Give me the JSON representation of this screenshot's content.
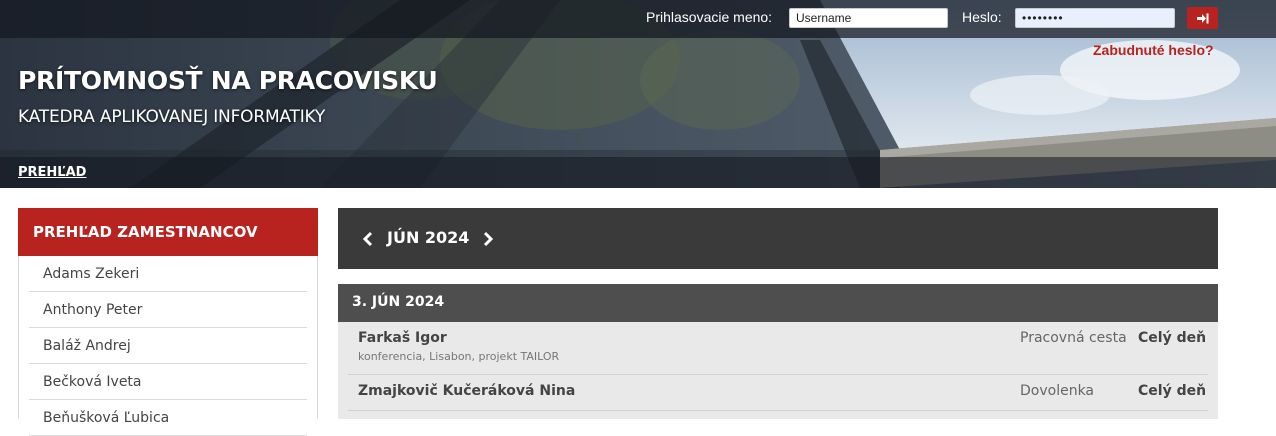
{
  "login": {
    "username_label": "Prihlasovacie meno:",
    "username_value": "Username",
    "password_label": "Heslo:",
    "password_value": "••••••••",
    "submit_icon": "sign-in-icon",
    "forgot_link": "Zabudnuté heslo?"
  },
  "header": {
    "title": "PRÍTOMNOSŤ NA PRACOVISKU",
    "subtitle": "KATEDRA APLIKOVANEJ INFORMATIKY"
  },
  "nav": {
    "items": [
      {
        "label": "PREHĽAD"
      }
    ]
  },
  "sidebar": {
    "title": "PREHĽAD ZAMESTNANCOV",
    "employees": [
      {
        "name": "Adams Zekeri"
      },
      {
        "name": "Anthony Peter"
      },
      {
        "name": "Baláž Andrej"
      },
      {
        "name": "Bečková Iveta"
      },
      {
        "name": "Beňušková Ľubica"
      }
    ]
  },
  "calendar": {
    "month_label": "JÚN 2024",
    "prev_icon": "chevron-left-icon",
    "next_icon": "chevron-right-icon",
    "days": [
      {
        "title": "3. JÚN 2024",
        "entries": [
          {
            "name": "Farkaš Igor",
            "note": "konferencia, Lisabon, projekt TAILOR",
            "type": "Pracovná cesta",
            "when": "Celý deň"
          },
          {
            "name": "Zmajkovič Kučeráková Nina",
            "note": "",
            "type": "Dovolenka",
            "when": "Celý deň"
          }
        ]
      }
    ]
  },
  "colors": {
    "accent": "#b8231f",
    "month_bar": "#3a3a3a",
    "day_header": "#4e4e4e",
    "entry_bg": "#e9e9e9"
  }
}
